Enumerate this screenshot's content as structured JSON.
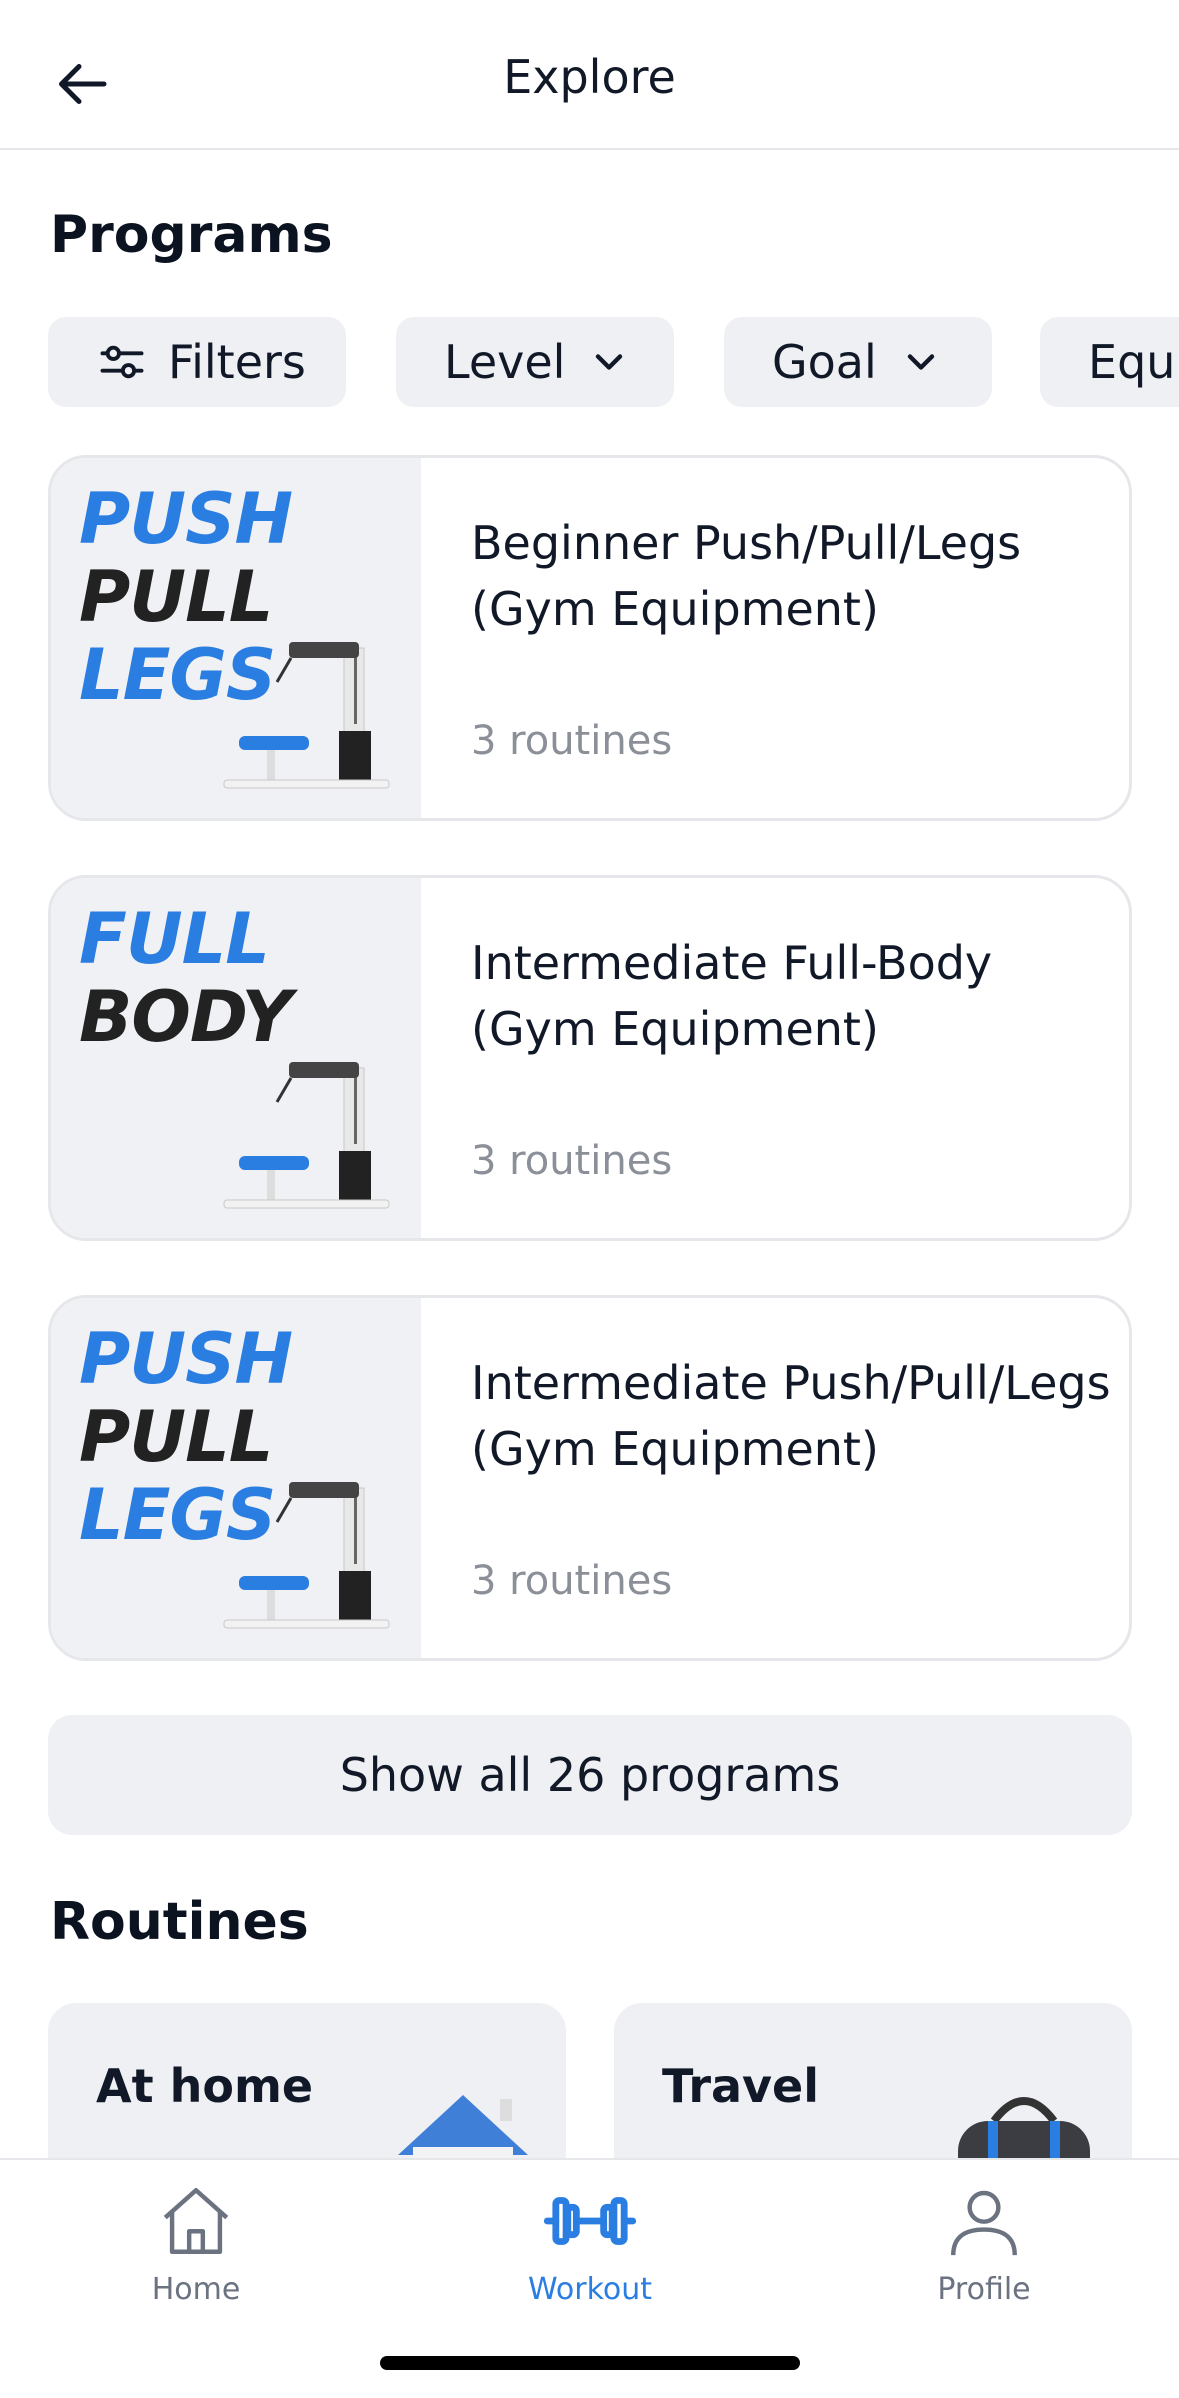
{
  "header": {
    "title": "Explore",
    "back_icon": "arrow-left-icon"
  },
  "programs": {
    "heading": "Programs",
    "chips": [
      {
        "label": "Filters",
        "icon": "sliders-icon"
      },
      {
        "label": "Level",
        "icon": "chevron-down-icon"
      },
      {
        "label": "Goal",
        "icon": "chevron-down-icon"
      },
      {
        "label": "Equi"
      }
    ],
    "items": [
      {
        "thumb_lines": [
          "PUSH",
          "PULL",
          "LEGS"
        ],
        "name_line1": "Beginner Push/Pull/Legs",
        "name_line2": "(Gym Equipment)",
        "meta": "3 routines"
      },
      {
        "thumb_lines": [
          "FULL",
          "BODY"
        ],
        "name_line1": "Intermediate Full-Body",
        "name_line2": "(Gym Equipment)",
        "meta": "3 routines"
      },
      {
        "thumb_lines": [
          "PUSH",
          "PULL",
          "LEGS"
        ],
        "name_line1": "Intermediate Push/Pull/Legs",
        "name_line2": "(Gym Equipment)",
        "meta": "3 routines"
      }
    ],
    "show_all": "Show all 26 programs"
  },
  "routines": {
    "heading": "Routines",
    "cards": [
      {
        "title": "At home",
        "icon": "house-icon"
      },
      {
        "title": "Travel",
        "icon": "duffel-bag-icon"
      }
    ]
  },
  "tabbar": {
    "tabs": [
      {
        "label": "Home",
        "icon": "home-icon",
        "active": false
      },
      {
        "label": "Workout",
        "icon": "dumbbell-icon",
        "active": true
      },
      {
        "label": "Profile",
        "icon": "user-icon",
        "active": false
      }
    ]
  },
  "colors": {
    "accent": "#2a7de1",
    "chip_bg": "#eef0f3",
    "muted_text": "#8a8f98",
    "inactive_tab": "#6b7280"
  }
}
